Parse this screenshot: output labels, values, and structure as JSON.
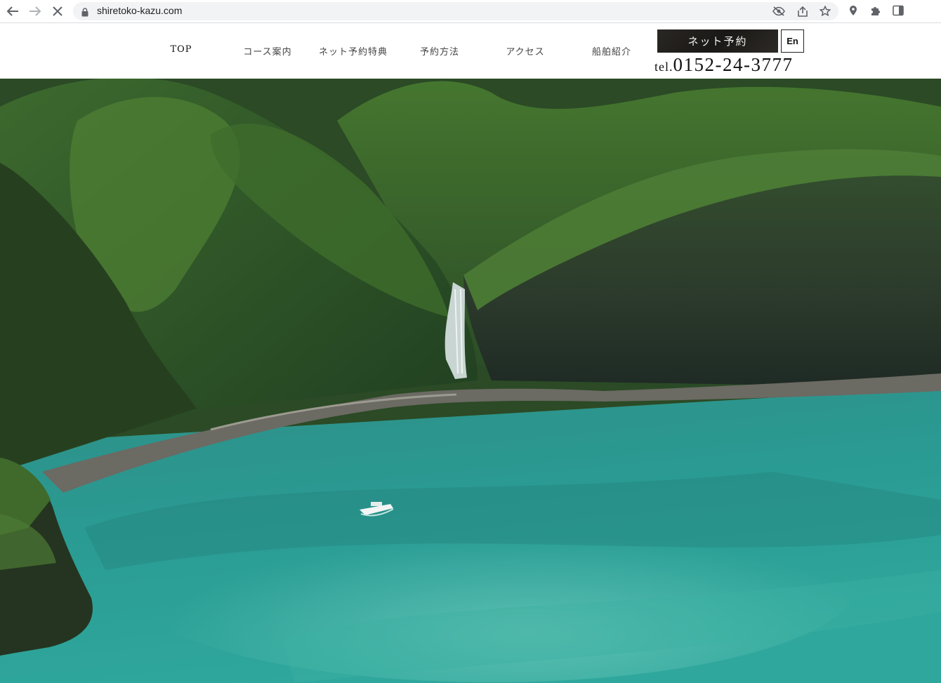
{
  "browser": {
    "url": "shiretoko-kazu.com",
    "icons": [
      "back-icon",
      "forward-icon",
      "stop-icon",
      "lock-icon",
      "eye-off-icon",
      "share-icon",
      "star-icon",
      "location-pin-icon",
      "puzzle-icon",
      "side-panel-icon"
    ]
  },
  "nav": {
    "items": [
      {
        "label": "TOP"
      },
      {
        "label": "コース案内"
      },
      {
        "label": "ネット予約特典"
      },
      {
        "label": "予約方法"
      },
      {
        "label": "アクセス"
      },
      {
        "label": "船舶紹介"
      }
    ],
    "reserve_label": "ネット予約",
    "lang_label": "En",
    "tel_prefix": "tel.",
    "tel_number": "0152-24-3777"
  },
  "hero": {
    "image_desc": "aerial-coastline-waterfall-boat"
  },
  "colors": {
    "reserve_bg": "#1f1d1b",
    "sea": "#2a9a93",
    "forest": "#2f5a2a"
  }
}
